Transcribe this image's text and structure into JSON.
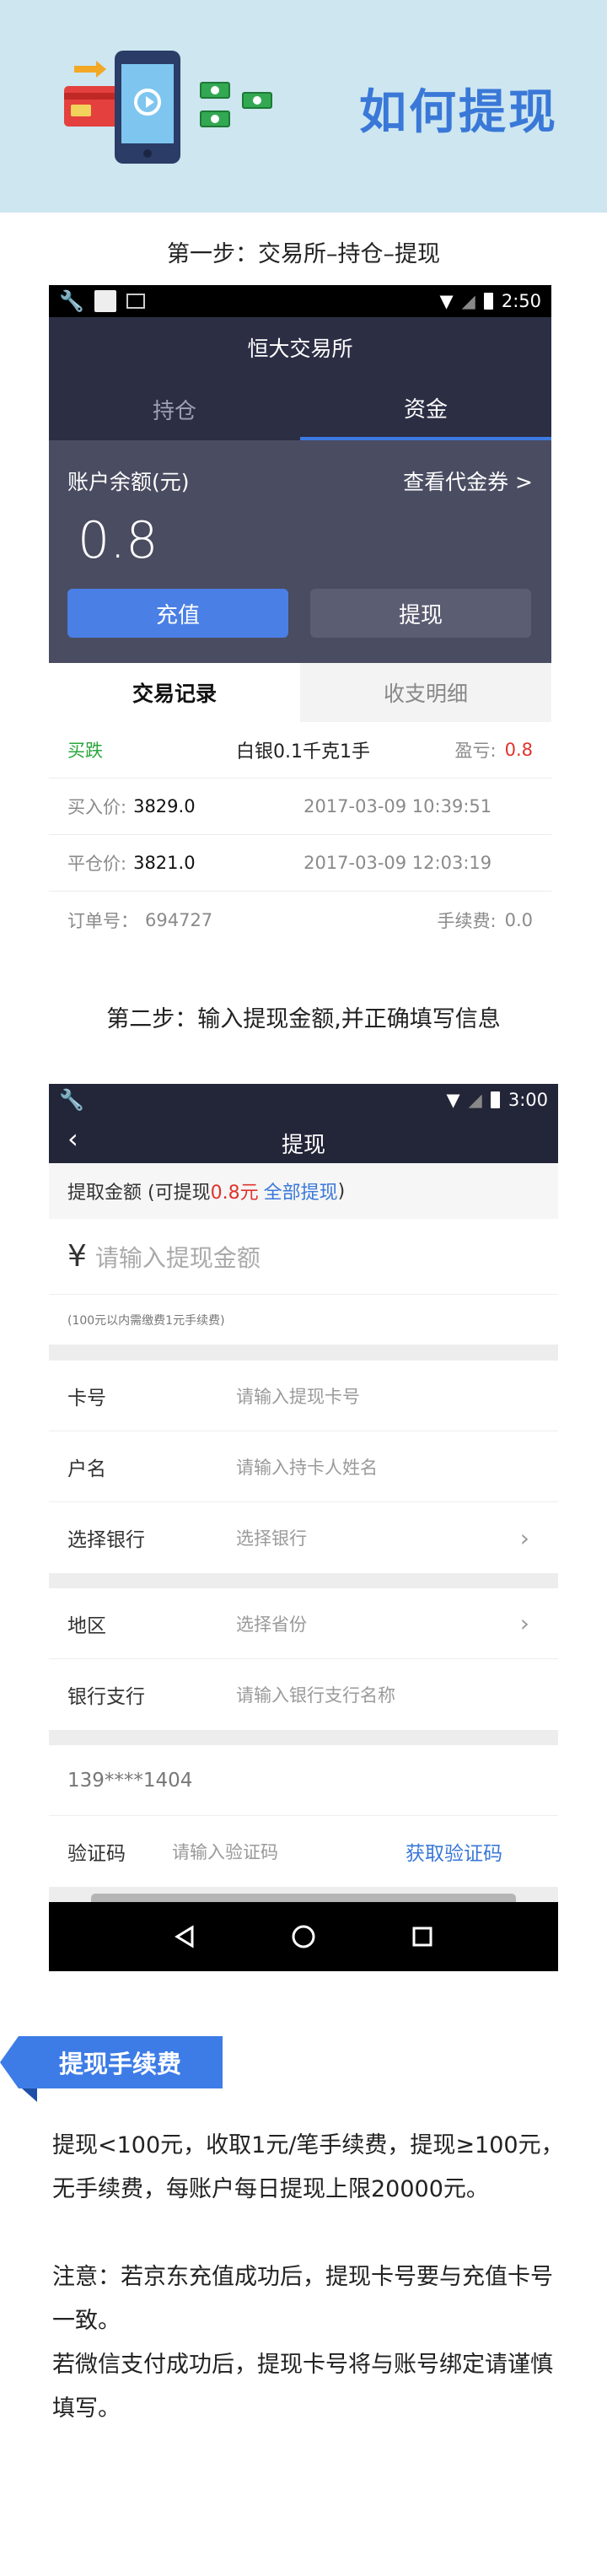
{
  "hero": {
    "title": "如何提现"
  },
  "steps": {
    "step1": "第一步：交易所–持仓–提现",
    "step2": "第二步：输入提现金额,并正确填写信息"
  },
  "shot1": {
    "status_time": "2:50",
    "app_title": "恒大交易所",
    "tabs": [
      "持仓",
      "资金"
    ],
    "balance_label": "账户余额(元)",
    "coupon_link": "查看代金券 >",
    "balance": "0.8",
    "recharge": "充值",
    "withdraw": "提现",
    "subtabs": [
      "交易记录",
      "收支明细"
    ],
    "record": {
      "direction": "买跌",
      "product": "白银0.1千克1手",
      "pl_label": "盈亏:",
      "pl_value": "0.8",
      "buy_label": "买入价:",
      "buy_price": "3829.0",
      "buy_time": "2017-03-09 10:39:51",
      "close_label": "平仓价:",
      "close_price": "3821.0",
      "close_time": "2017-03-09 12:03:19",
      "order_label": "订单号：",
      "order_no": "694727",
      "fee_label": "手续费:",
      "fee": "0.0"
    }
  },
  "shot2": {
    "status_time": "3:00",
    "title": "提现",
    "amount_label_pre": "提取金额 (可提现",
    "amount_avail": "0.8元",
    "amount_all": "全部提现",
    "amount_label_post": ")",
    "currency": "¥",
    "amount_placeholder": "请输入提现金额",
    "fee_hint": "(100元以内需缴费1元手续费)",
    "fields": [
      {
        "label": "卡号",
        "placeholder": "请输入提现卡号"
      },
      {
        "label": "户名",
        "placeholder": "请输入持卡人姓名"
      },
      {
        "label": "选择银行",
        "placeholder": "选择银行"
      },
      {
        "label": "地区",
        "placeholder": "选择省份"
      },
      {
        "label": "银行支行",
        "placeholder": "请输入银行支行名称"
      }
    ],
    "phone": "139****1404",
    "code_label": "验证码",
    "code_placeholder": "请输入验证码",
    "get_code": "获取验证码"
  },
  "fee_section": {
    "tag": "提现手续费",
    "para1": "提现<100元，收取1元/笔手续费，提现≥100元，无手续费，每账户每日提现上限20000元。",
    "para2_l1": "注意：若京东充值成功后，提现卡号要与充值卡号一致。",
    "para2_l2": "若微信支付成功后，提现卡号将与账号绑定请谨慎填写。"
  },
  "colors": {
    "accent": "#3a78d8",
    "header_bg": "#cde6f0",
    "dark": "#2c2e44",
    "green": "#2aa63c",
    "red": "#e0332b"
  }
}
